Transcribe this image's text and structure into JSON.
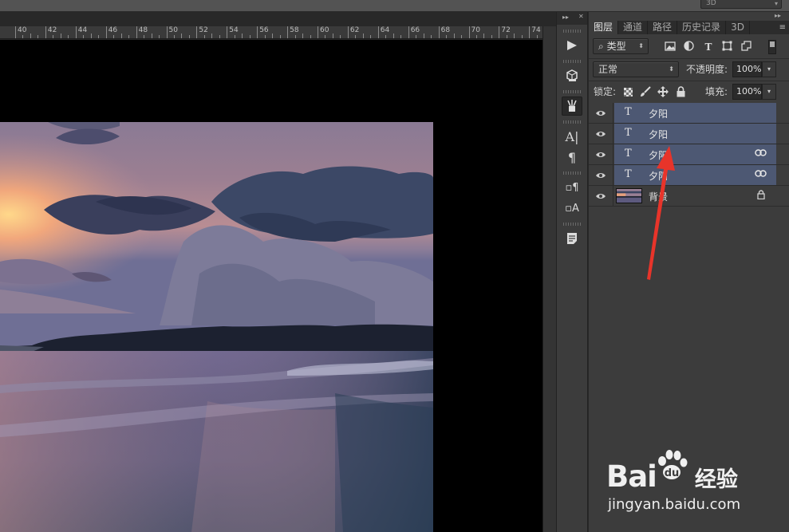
{
  "topbar": {
    "mode_value": "3D"
  },
  "ruler": {
    "ticks": [
      "40",
      "42",
      "44",
      "46",
      "48",
      "50",
      "52",
      "54",
      "56",
      "58",
      "60",
      "62",
      "64",
      "66",
      "68",
      "70",
      "72",
      "74"
    ]
  },
  "dock": {
    "header_left": "▸▸",
    "header_close": "✕",
    "header_right": "▸▸"
  },
  "panel": {
    "menu_icon": "≡",
    "tabs": [
      {
        "label": "图层"
      },
      {
        "label": "通道"
      },
      {
        "label": "路径"
      },
      {
        "label": "历史记录"
      },
      {
        "label": "3D"
      }
    ],
    "filter": {
      "kind_label": "类型",
      "search_glyph": "⌕"
    },
    "blend": {
      "mode": "正常",
      "opacity_label": "不透明度:",
      "opacity_value": "100%"
    },
    "lock": {
      "label": "锁定:",
      "fill_label": "填充:",
      "fill_value": "100%"
    },
    "layers": [
      {
        "name": "夕阳",
        "kind": "text",
        "selected": true,
        "linked": false
      },
      {
        "name": "夕阳",
        "kind": "text",
        "selected": true,
        "linked": false
      },
      {
        "name": "夕阳",
        "kind": "text",
        "selected": true,
        "linked": true
      },
      {
        "name": "夕阳",
        "kind": "text",
        "selected": true,
        "linked": true
      },
      {
        "name": "背景",
        "kind": "image",
        "selected": false,
        "locked": true
      }
    ],
    "text_layer_glyph": "T"
  },
  "watermark": {
    "brand": "Bai",
    "brand_cn": "经验",
    "url": "jingyan.baidu.com"
  },
  "colors": {
    "selection": "#4d5873",
    "arrow": "#e8342a"
  }
}
